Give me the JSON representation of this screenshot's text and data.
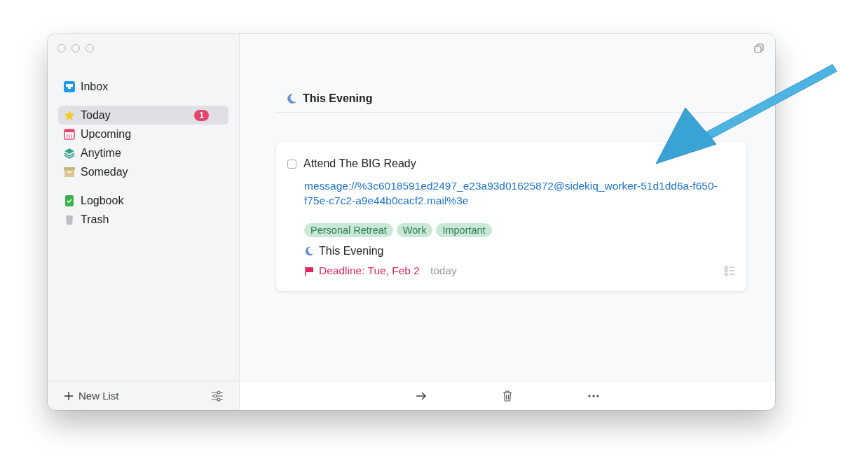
{
  "sidebar": {
    "groups": [
      [
        {
          "label": "Inbox",
          "kind": "inbox",
          "selected": false
        }
      ],
      [
        {
          "label": "Today",
          "kind": "today",
          "selected": true,
          "badge": "1"
        },
        {
          "label": "Upcoming",
          "kind": "upcoming",
          "selected": false
        },
        {
          "label": "Anytime",
          "kind": "anytime",
          "selected": false
        },
        {
          "label": "Someday",
          "kind": "someday",
          "selected": false
        }
      ],
      [
        {
          "label": "Logbook",
          "kind": "logbook",
          "selected": false
        },
        {
          "label": "Trash",
          "kind": "trash",
          "selected": false
        }
      ]
    ],
    "new_list": "New List"
  },
  "section": {
    "title": "This Evening"
  },
  "task": {
    "title": "Attend The BIG Ready",
    "checked": false,
    "notes_link": "message://%3c6018591ed2497_e23a93d01625872@sidekiq_worker-51d1dd6a-f650-f75e-c7c2-a9e44b0cacf2.mail%3e",
    "tags": [
      "Personal Retreat",
      "Work",
      "Important"
    ],
    "when": "This Evening",
    "deadline": "Deadline: Tue, Feb 2",
    "deadline_relative": "today"
  }
}
